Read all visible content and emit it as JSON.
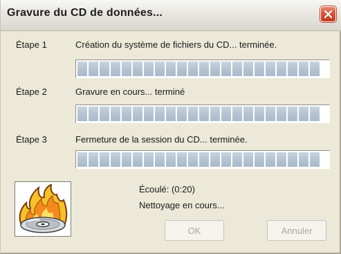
{
  "window": {
    "title": "Gravure du CD de données...",
    "close_icon": "close-icon"
  },
  "steps": [
    {
      "label": "Étape 1",
      "text": "Création du système de fichiers du CD... terminée.",
      "progress": 1.0
    },
    {
      "label": "Étape 2",
      "text": "Gravure en cours...  terminé",
      "progress": 1.0
    },
    {
      "label": "Étape 3",
      "text": "Fermeture de la session du CD... terminée.",
      "progress": 1.0
    }
  ],
  "status": {
    "elapsed": "Écoulé: (0:20)",
    "message": "Nettoyage en cours..."
  },
  "buttons": {
    "ok": "OK",
    "cancel": "Annuler"
  },
  "icons": {
    "app_icon": "cd-burning-icon"
  },
  "colors": {
    "window_bg": "#ECE9D8",
    "progress_fill": "#B4C4D2",
    "close_button": "#D8553A"
  }
}
